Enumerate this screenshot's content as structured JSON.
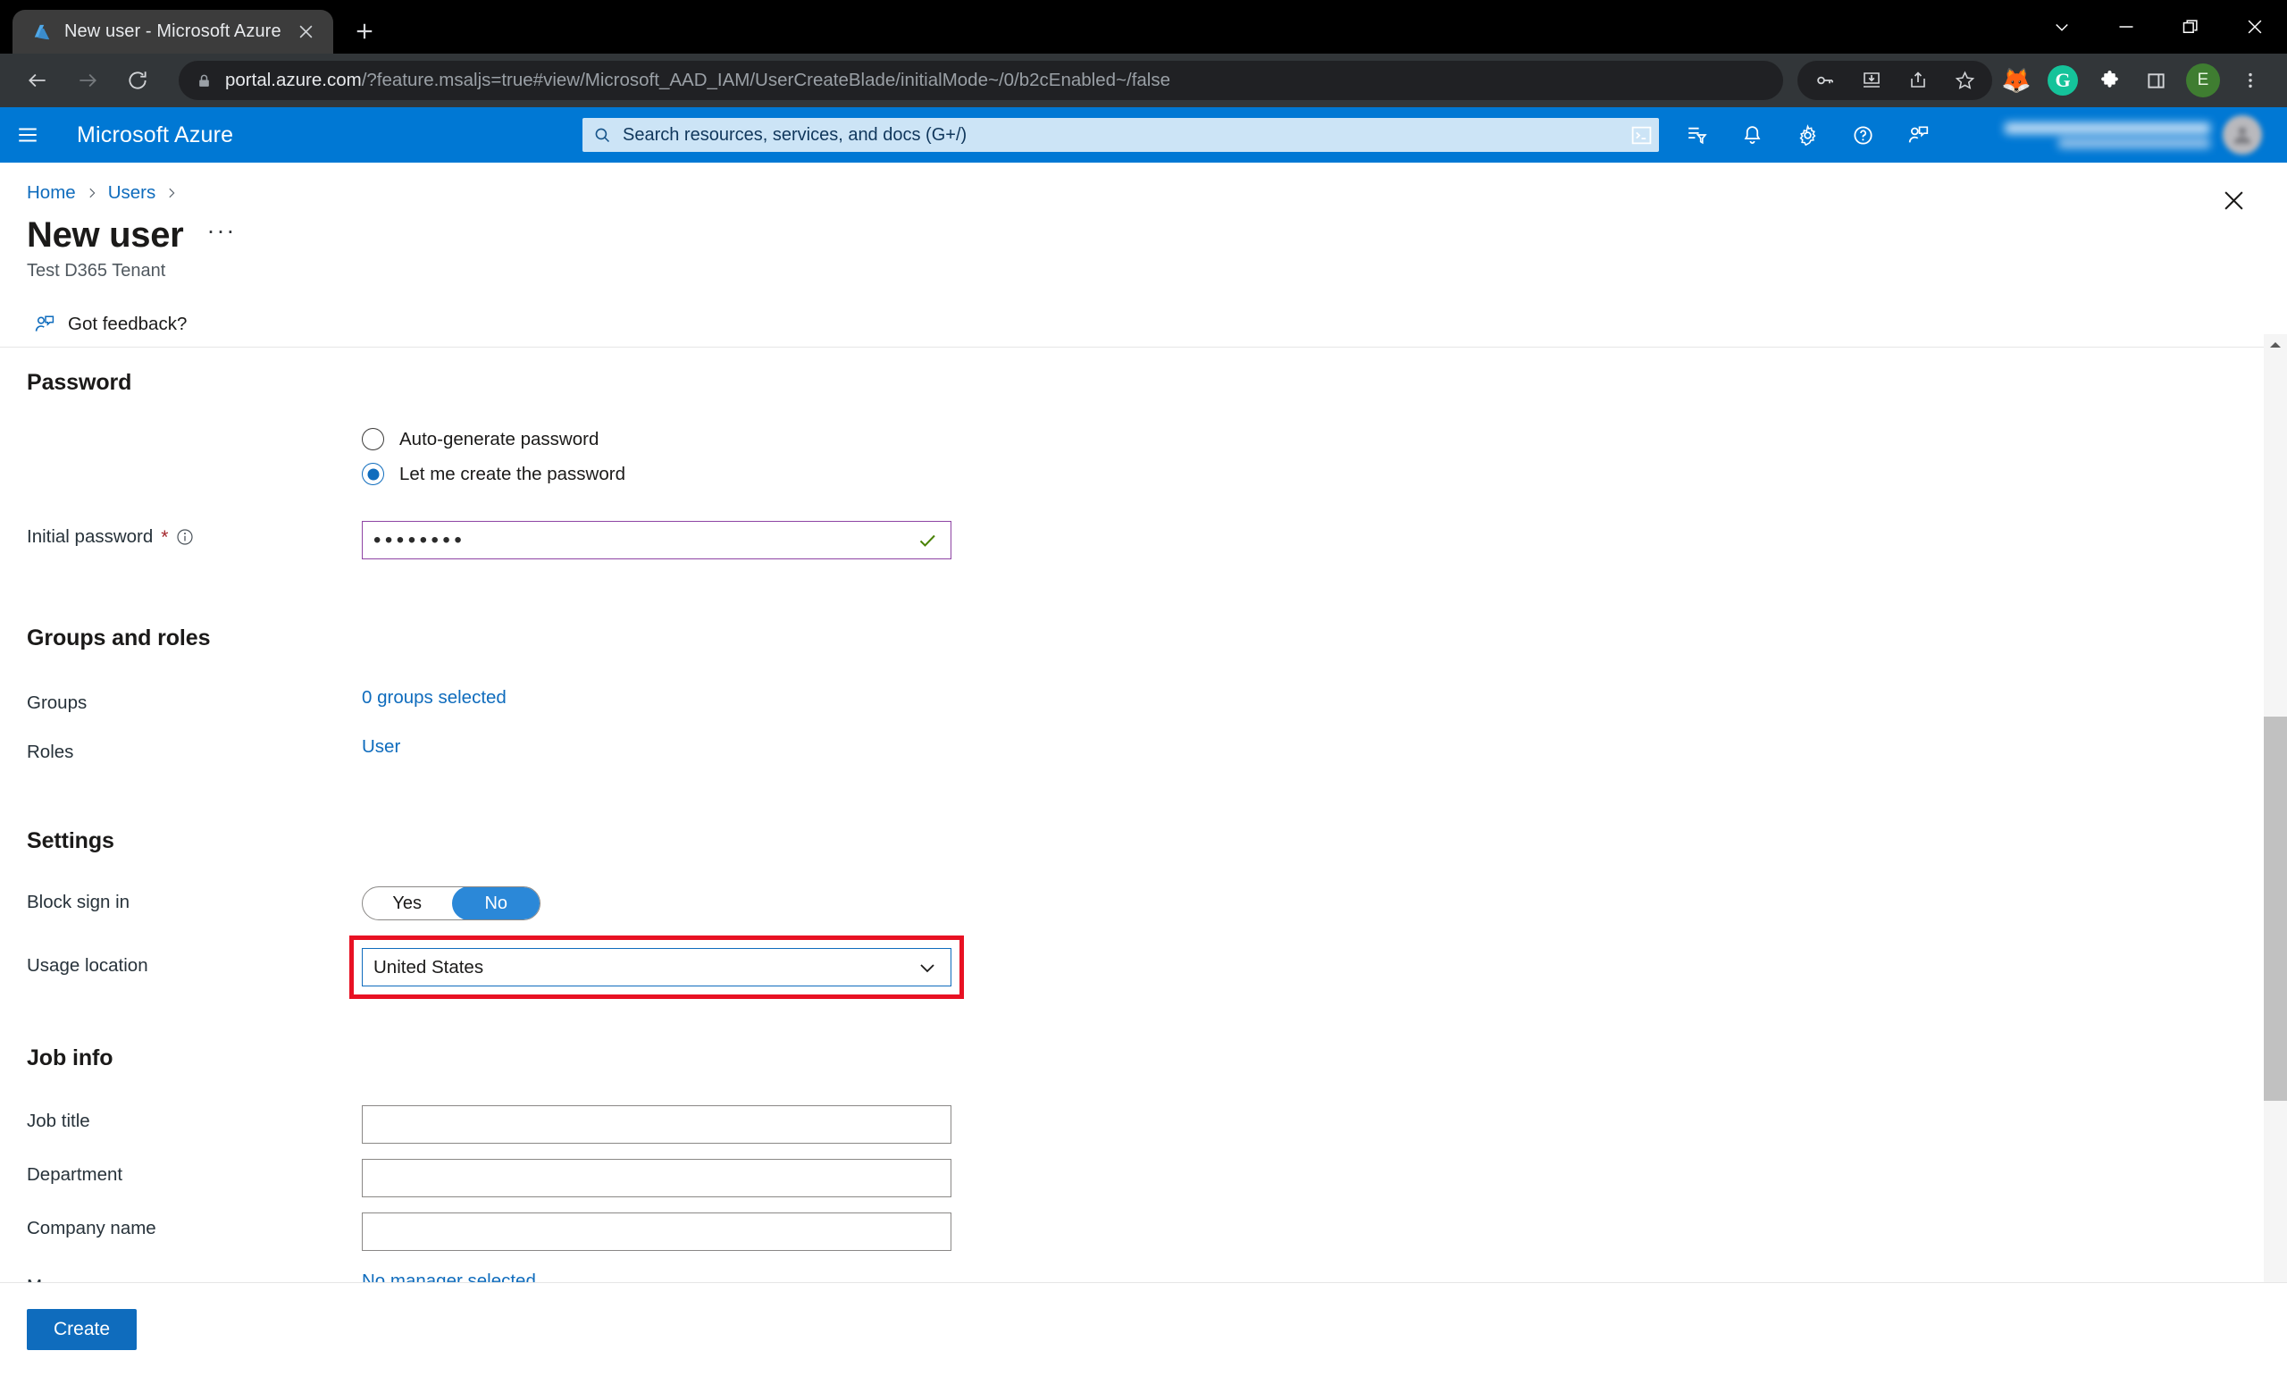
{
  "browser": {
    "tab": {
      "title": "New user - Microsoft Azure",
      "favicon": "azure-logo-icon"
    },
    "newtab_label": "+",
    "window_controls": [
      "chevron-down-icon",
      "minimize-icon",
      "restore-icon",
      "close-icon"
    ],
    "nav": {
      "back": "back-arrow-icon",
      "forward": "forward-arrow-icon",
      "reload": "reload-icon"
    },
    "omnibox": {
      "lock": "lock-icon",
      "url_domain": "portal.azure.com",
      "url_path": "/?feature.msaljs=true#view/Microsoft_AAD_IAM/UserCreateBlade/initialMode~/0/b2cEnabled~/false"
    },
    "toolbar_icons": [
      "key-icon",
      "install-icon",
      "share-icon",
      "bookmark-star-icon",
      "metamask-fox-icon",
      "grammarly-icon",
      "extensions-puzzle-icon",
      "side-panel-icon"
    ],
    "profile_initial": "E",
    "menu_icon": "three-dot-menu-icon"
  },
  "azure_header": {
    "hamburger": "hamburger-menu-icon",
    "brand": "Microsoft Azure",
    "search": {
      "icon": "search-icon",
      "placeholder": "Search resources, services, and docs (G+/)"
    },
    "icons": [
      "cloud-shell-icon",
      "directories-subscriptions-icon",
      "notifications-bell-icon",
      "settings-gear-icon",
      "help-question-icon",
      "feedback-icon"
    ],
    "account_blurred": true
  },
  "blade": {
    "breadcrumb": [
      {
        "label": "Home"
      },
      {
        "label": "Users"
      }
    ],
    "title": "New user",
    "ellipsis": "···",
    "subtitle": "Test D365 Tenant",
    "close_icon": "close-icon",
    "command_bar": {
      "icon": "feedback-icon",
      "label": "Got feedback?"
    }
  },
  "form": {
    "password_section": {
      "heading": "Password",
      "options": [
        {
          "label": "Auto-generate password",
          "checked": false
        },
        {
          "label": "Let me create the password",
          "checked": true
        }
      ],
      "initial_password": {
        "label": "Initial password",
        "required_marker": "*",
        "info_icon": "info-icon",
        "value_mask": "••••••••",
        "valid_icon": "checkmark-icon",
        "border_color": "#8e44a4"
      }
    },
    "groups_roles_section": {
      "heading": "Groups and roles",
      "rows": [
        {
          "label": "Groups",
          "value": "0 groups selected",
          "type": "link"
        },
        {
          "label": "Roles",
          "value": "User",
          "type": "link"
        }
      ]
    },
    "settings_section": {
      "heading": "Settings",
      "block_sign_in": {
        "label": "Block sign in",
        "options": [
          "Yes",
          "No"
        ],
        "selected": "No"
      },
      "usage_location": {
        "label": "Usage location",
        "selected": "United States",
        "chevron": "chevron-down-icon",
        "highlighted": true,
        "highlight_color": "#e81123",
        "focus_border_color": "#0f6cbd"
      }
    },
    "job_info_section": {
      "heading": "Job info",
      "fields": [
        {
          "label": "Job title",
          "value": "",
          "type": "text"
        },
        {
          "label": "Department",
          "value": "",
          "type": "text"
        },
        {
          "label": "Company name",
          "value": "",
          "type": "text"
        },
        {
          "label": "Manager",
          "value": "No manager selected",
          "type": "link"
        }
      ]
    }
  },
  "footer": {
    "create_label": "Create"
  },
  "scrollbar": {
    "up_arrow": "scroll-up-arrow-icon"
  },
  "colors": {
    "azure_blue": "#0078d4",
    "link_blue": "#0f6cbd",
    "toggle_on": "#2b88d8",
    "annotation_red": "#e81123",
    "password_purple": "#8e44a4",
    "valid_green": "#498205"
  }
}
